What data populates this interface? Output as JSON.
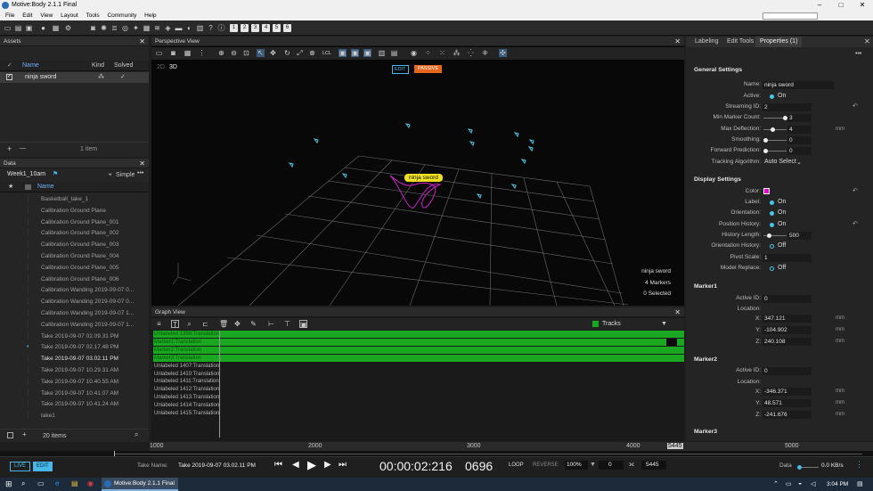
{
  "window": {
    "title": "Motive:Body 2.1.1 Final",
    "min": "–",
    "max": "□",
    "close": "✕"
  },
  "menu": [
    "File",
    "Edit",
    "View",
    "Layout",
    "Tools",
    "Community",
    "Help"
  ],
  "toolbar": {
    "layouts": [
      "1",
      "2",
      "3",
      "4",
      "5",
      "6"
    ]
  },
  "assets": {
    "title": "Assets",
    "columns": {
      "name": "Name",
      "kind": "Kind",
      "solved": "Solved"
    },
    "items": [
      {
        "name": "ninja sword"
      }
    ],
    "count": "1 item",
    "add": "+",
    "remove": "—"
  },
  "data_panel": {
    "title": "Data",
    "session": "Week1_10am",
    "view_mode": "Simple",
    "column_name": "Name",
    "items": [
      "Basketball_take_1",
      "Calibration Ground Plane",
      "Calibration Ground Plane_001",
      "Calibration Ground Plane_002",
      "Calibration Ground Plane_003",
      "Calibration Ground Plane_004",
      "Calibration Ground Plane_005",
      "Calibration Ground Plane_006",
      "Calibration Wanding 2019-09-07 0...",
      "Calibration Wanding 2019-09-07 0...",
      "Calibration Wanding 2019-09-07 1...",
      "Calibration Wanding 2019-09-07 1...",
      "Take 2019-09-07 02.09.31 PM",
      "Take 2019-09-07 02.17.48 PM",
      "Take 2019-09-07 03.02.11 PM",
      "Take 2019-09-07 10.29.31 AM",
      "Take 2019-09-07 10.40.55 AM",
      "Take 2019-09-07 10.41.07 AM",
      "Take 2019-09-07 10.41.24 AM",
      "take1"
    ],
    "count": "20 items"
  },
  "perspective": {
    "title": "Perspective View",
    "mode_2d": "2D",
    "mode_3d": "3D",
    "edit": "EDIT",
    "passive": "PASSIVE",
    "asset_label": "ninja sword",
    "info": [
      "ninja sword",
      "4 Markers",
      "0 Selected"
    ],
    "lcl": "LCL"
  },
  "graph": {
    "title": "Graph View",
    "tracks_label": "Tracks",
    "tracks": [
      {
        "name": "Unlabeled 1398:Translation",
        "style": "g"
      },
      {
        "name": "Marker1:Translation",
        "style": "g"
      },
      {
        "name": "Marker2:Translation",
        "style": "g"
      },
      {
        "name": "Marker3:Translation",
        "style": "g"
      },
      {
        "name": "Unlabeled 1407:Translation",
        "style": "d"
      },
      {
        "name": "Unlabeled 1410:Translation",
        "style": "d"
      },
      {
        "name": "Unlabeled 1411:Translation",
        "style": "d"
      },
      {
        "name": "Unlabeled 1412:Translation",
        "style": "d"
      },
      {
        "name": "Unlabeled 1413:Translation",
        "style": "d"
      },
      {
        "name": "Unlabeled 1414:Translation",
        "style": "d"
      },
      {
        "name": "Unlabeled 1415:Translation",
        "style": "d"
      }
    ],
    "ruler": [
      "1000",
      "2000",
      "3000",
      "4000",
      "5000"
    ],
    "end_frame": "5445"
  },
  "right": {
    "tabs": [
      "Labeling",
      "Edit Tools",
      "Properties (1)"
    ],
    "general": {
      "title": "General Settings",
      "name_label": "Name:",
      "name": "ninja sword",
      "active_label": "Active:",
      "active": "On",
      "streaming_label": "Streaming ID:",
      "streaming": "2",
      "minmarker_label": "Min Marker Count:",
      "minmarker": "3",
      "maxdef_label": "Max Deflection:",
      "maxdef": "4",
      "maxdef_unit": "mm",
      "smooth_label": "Smoothing:",
      "smooth": "0",
      "fwd_label": "Forward Prediction:",
      "fwd": "0",
      "algo_label": "Tracking Algorithm:",
      "algo": "Auto Select"
    },
    "display": {
      "title": "Display Settings",
      "color_label": "Color:",
      "color": "#e000e0",
      "label_label": "Label:",
      "label": "On",
      "orient_label": "Orientation:",
      "orient": "On",
      "poshist_label": "Position History:",
      "poshist": "On",
      "histlen_label": "History Length:",
      "histlen": "500",
      "orienthist_label": "Orientation History:",
      "orienthist": "Off",
      "pivot_label": "Pivot Scale:",
      "pivot": "1",
      "replace_label": "Model Replace:",
      "replace": "Off"
    },
    "marker1": {
      "title": "Marker1",
      "id_label": "Active ID:",
      "id": "0",
      "loc_label": "Location:",
      "x": "347.121",
      "y": "-104.902",
      "z": "240.108"
    },
    "marker2": {
      "title": "Marker2",
      "id_label": "Active ID:",
      "id": "0",
      "loc_label": "Location:",
      "x": "-346.371",
      "y": "48.571",
      "z": "-241.676"
    },
    "marker3": {
      "title": "Marker3"
    },
    "axis": {
      "x": "X:",
      "y": "Y:",
      "z": "Z:"
    },
    "mm": "mm"
  },
  "transport": {
    "live": "LIVE",
    "edit": "EDIT",
    "take_label": "Take Name:",
    "take": "Take 2019-09-07 03.02.11 PM",
    "timecode": "00:00:02:216",
    "frame": "0696",
    "loop": "LOOP",
    "reverse": "REVERSE",
    "speed": "100%",
    "start": "0",
    "end": "5445",
    "data_label": "Data",
    "rate": "0.0 KB/s"
  },
  "taskbar": {
    "app": "Motive:Body 2.1.1 Final",
    "time": "3:04 PM"
  }
}
